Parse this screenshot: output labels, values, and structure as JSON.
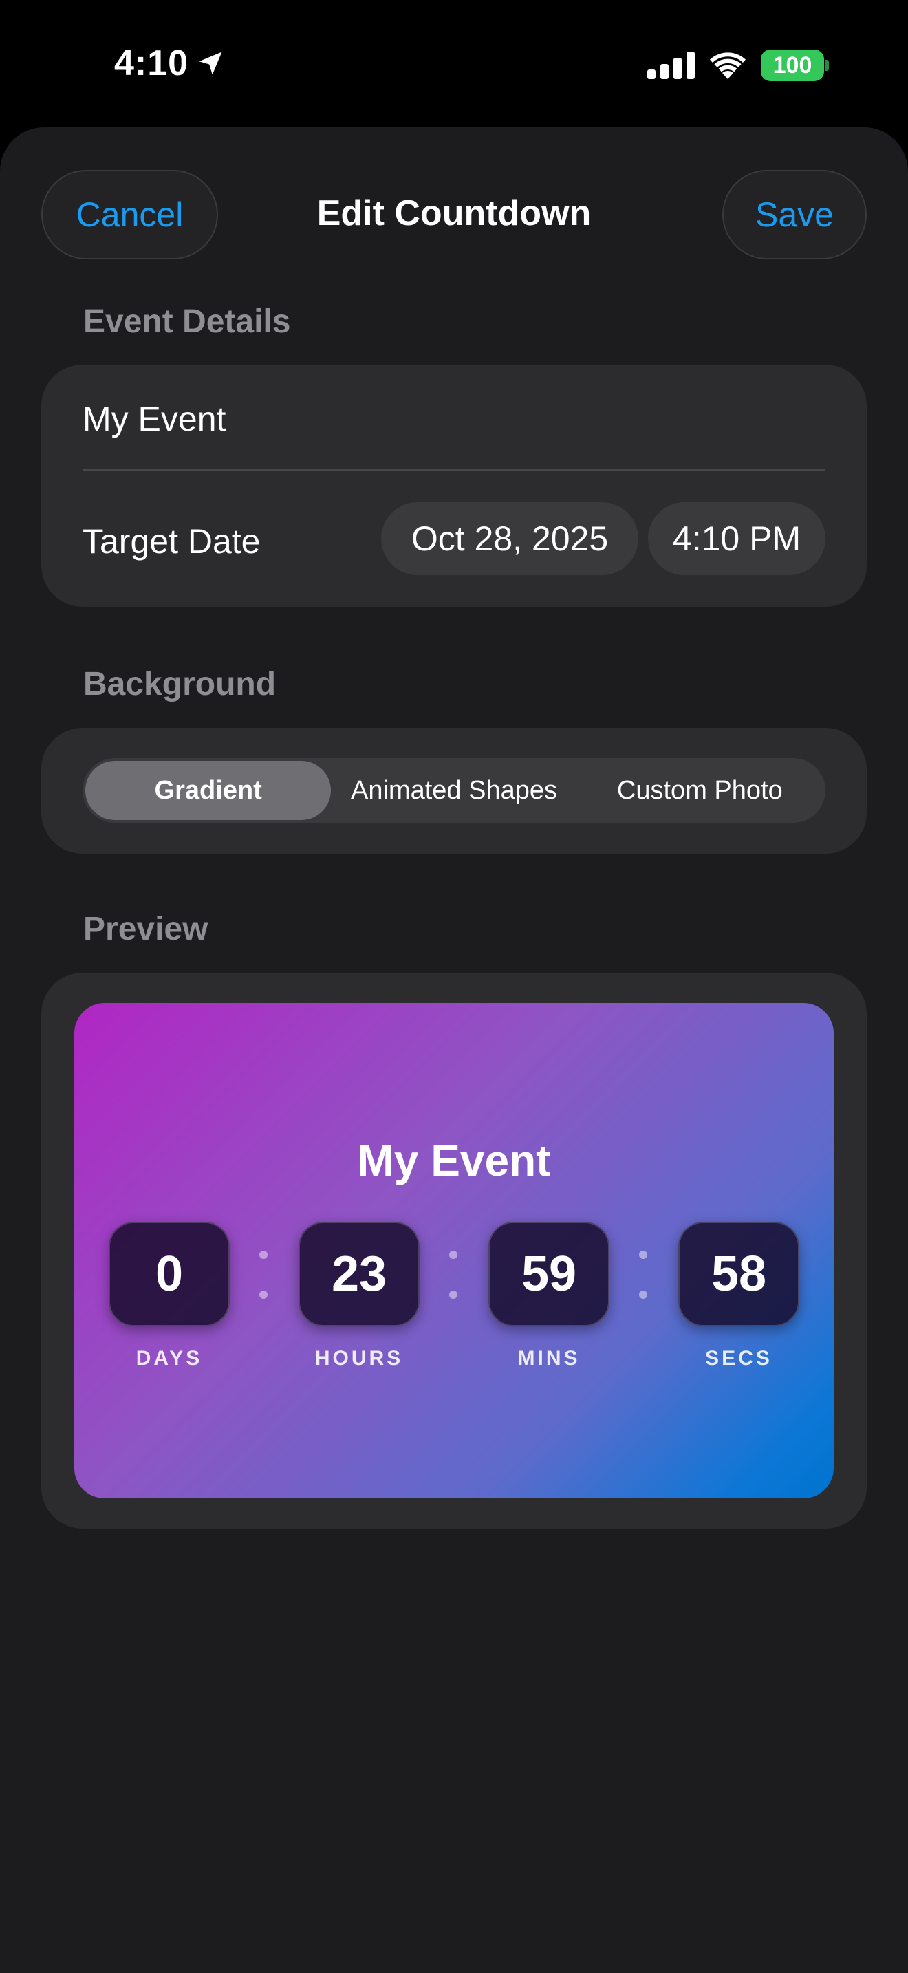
{
  "status": {
    "time": "4:10",
    "battery": "100"
  },
  "nav": {
    "cancel": "Cancel",
    "title": "Edit Countdown",
    "save": "Save"
  },
  "event_details": {
    "header": "Event Details",
    "name": "My Event",
    "target_label": "Target Date",
    "date": "Oct 28, 2025",
    "time": "4:10 PM"
  },
  "background": {
    "header": "Background",
    "options": [
      "Gradient",
      "Animated Shapes",
      "Custom Photo"
    ],
    "selected": "Gradient"
  },
  "preview": {
    "header": "Preview",
    "title": "My Event",
    "units": [
      {
        "value": "0",
        "label": "DAYS"
      },
      {
        "value": "23",
        "label": "HOURS"
      },
      {
        "value": "59",
        "label": "MINS"
      },
      {
        "value": "58",
        "label": "SECS"
      }
    ],
    "gradient_colors": [
      "#b126c4",
      "#8e55c4",
      "#5d6bcb",
      "#0073cf"
    ]
  },
  "colors": {
    "accent": "#1a9bf0",
    "battery": "#34c759"
  }
}
